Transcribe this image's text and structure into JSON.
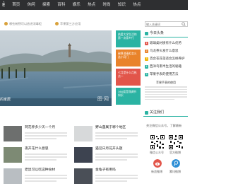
{
  "nav": {
    "logo": "Ê",
    "items": [
      "首页",
      "休闲",
      "探索",
      "百科",
      "娱乐",
      "热点",
      "时尚",
      "知识",
      "热点"
    ]
  },
  "breadcrumb": {
    "items": [
      "哪些碗筷可以放进消毒柜",
      "苹果第三方应用"
    ]
  },
  "search": {
    "placeholder": "输入关键词"
  },
  "hero": {
    "caption": "的家居"
  },
  "tiles": [
    {
      "text": "热爱大学生活的第一次家乡行",
      "color": "#2bb3a3"
    },
    {
      "text": "碗筷消毒柜怎么选小窍门",
      "color": "#e9832a"
    },
    {
      "text": "七月是什么月热点一",
      "color": "#e2554a"
    },
    {
      "text": "360度音频调节知识",
      "color": "#2bb3a3"
    }
  ],
  "hot_panel": {
    "title": "今日头条",
    "items": [
      {
        "num": "1",
        "text": "玻璃类材质有什么优势",
        "color": "#e2554a"
      },
      {
        "num": "2",
        "text": "乌龙茶头发什么意思",
        "color": "#e9832a"
      },
      {
        "num": "3",
        "text": "百合花花茎适合怎样养护",
        "color": "#f0b400"
      },
      {
        "num": "4",
        "text": "西洋鸟南半生活的秘籍",
        "color": "#2bb3a3"
      },
      {
        "num": "5",
        "text": "苹果手表的使用方法",
        "color": "#2bb3a3"
      }
    ],
    "body_title": "苹果手表的使用"
  },
  "follow_panel": {
    "title": "关注我们",
    "text": "关注微信公众号，了解最新",
    "qr_labels": [
      "微信公众号",
      "官方微博"
    ],
    "social_labels": [
      "新浪微博",
      "腾讯微博"
    ]
  },
  "cards": [
    {
      "title": "荷花养多少天一个月",
      "thumb_color": "#6d6f6e"
    },
    {
      "title": "野山菌属于哪个地区",
      "thumb_color": "#d7d9da"
    },
    {
      "title": "夜开花什么意思",
      "thumb_color": "#7d8a74"
    },
    {
      "title": "遇见日月花开头题",
      "thumb_color": "#3d4350"
    },
    {
      "title": "老鼠可以吃这种食材",
      "thumb_color": "#b9bec2"
    },
    {
      "title": "金龟子有用吗",
      "thumb_color": "#4a4f57"
    }
  ]
}
